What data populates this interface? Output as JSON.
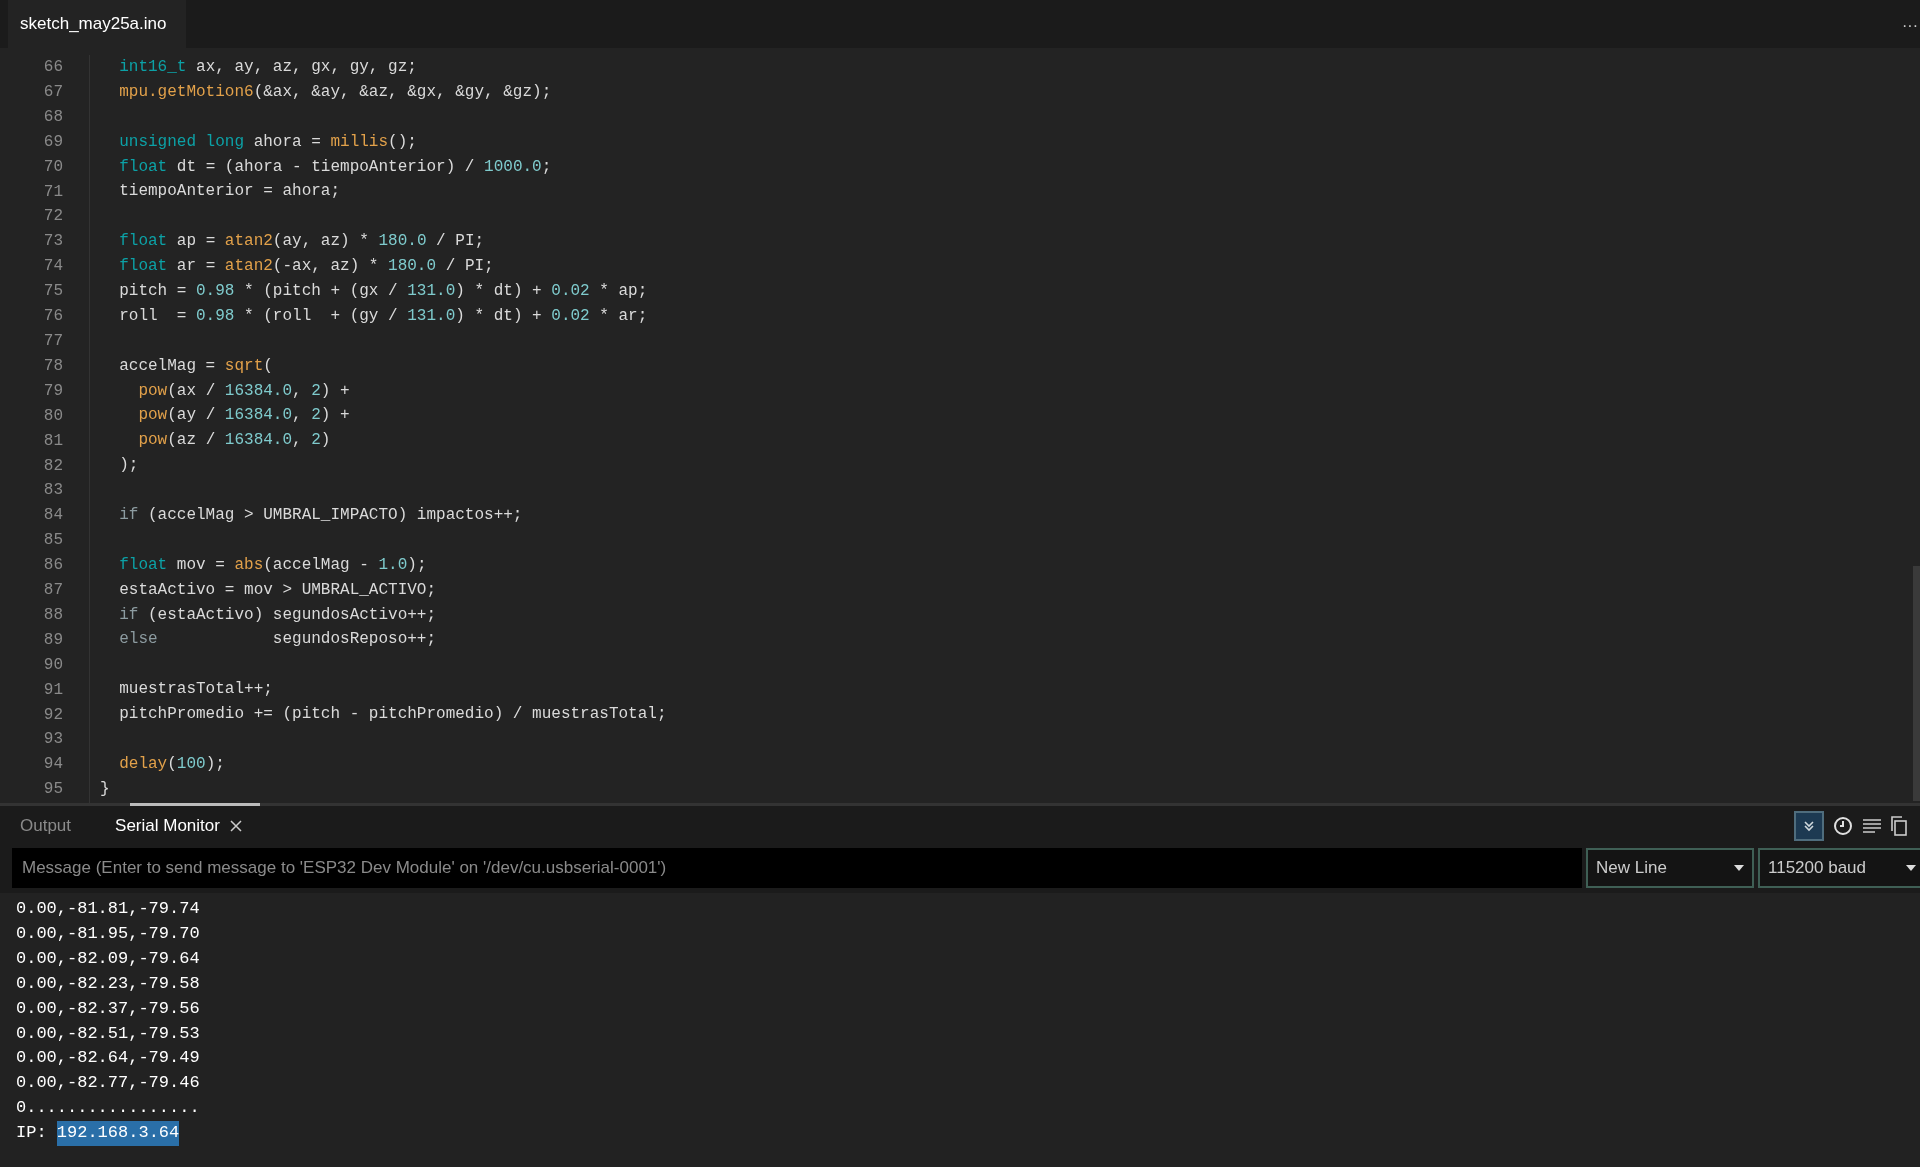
{
  "editor_tab": {
    "label": "sketch_may25a.ino",
    "selected": true
  },
  "more_menu": "···",
  "code_lines": [
    {
      "number": "66",
      "tokens": [
        {
          "kind": "type",
          "text": "  int16_t"
        },
        {
          "kind": "plain",
          "text": " ax, ay, az, gx, gy, gz;"
        }
      ]
    },
    {
      "number": "67",
      "tokens": [
        {
          "kind": "func",
          "text": "  mpu.getMotion6"
        },
        {
          "kind": "plain",
          "text": "(&ax, &ay, &az, &gx, &gy, &gz);"
        }
      ]
    },
    {
      "number": "68"
    },
    {
      "number": "69",
      "tokens": [
        {
          "kind": "type",
          "text": "  unsigned long"
        },
        {
          "kind": "plain",
          "text": " ahora = "
        },
        {
          "kind": "func",
          "text": "millis"
        },
        {
          "kind": "plain",
          "text": "();"
        }
      ]
    },
    {
      "number": "70",
      "tokens": [
        {
          "kind": "type",
          "text": "  float"
        },
        {
          "kind": "plain",
          "text": " dt = (ahora - tiempoAnterior) / "
        },
        {
          "kind": "number",
          "text": "1000.0"
        },
        {
          "kind": "plain",
          "text": ";"
        }
      ]
    },
    {
      "number": "71",
      "tokens": [
        {
          "kind": "plain",
          "text": "  tiempoAnterior = ahora;"
        }
      ]
    },
    {
      "number": "72"
    },
    {
      "number": "73",
      "tokens": [
        {
          "kind": "type",
          "text": "  float"
        },
        {
          "kind": "plain",
          "text": " ap = "
        },
        {
          "kind": "func",
          "text": "atan2"
        },
        {
          "kind": "plain",
          "text": "(ay, az) * "
        },
        {
          "kind": "number",
          "text": "180.0"
        },
        {
          "kind": "plain",
          "text": " / PI;"
        }
      ]
    },
    {
      "number": "74",
      "tokens": [
        {
          "kind": "type",
          "text": "  float"
        },
        {
          "kind": "plain",
          "text": " ar = "
        },
        {
          "kind": "func",
          "text": "atan2"
        },
        {
          "kind": "plain",
          "text": "(-ax, az) * "
        },
        {
          "kind": "number",
          "text": "180.0"
        },
        {
          "kind": "plain",
          "text": " / PI;"
        }
      ]
    },
    {
      "number": "75",
      "tokens": [
        {
          "kind": "plain",
          "text": "  pitch = "
        },
        {
          "kind": "number",
          "text": "0.98"
        },
        {
          "kind": "plain",
          "text": " * (pitch + (gx / "
        },
        {
          "kind": "number",
          "text": "131.0"
        },
        {
          "kind": "plain",
          "text": ") * dt) + "
        },
        {
          "kind": "number",
          "text": "0.02"
        },
        {
          "kind": "plain",
          "text": " * ap;"
        }
      ]
    },
    {
      "number": "76",
      "tokens": [
        {
          "kind": "plain",
          "text": "  roll  = "
        },
        {
          "kind": "number",
          "text": "0.98"
        },
        {
          "kind": "plain",
          "text": " * (roll  + (gy / "
        },
        {
          "kind": "number",
          "text": "131.0"
        },
        {
          "kind": "plain",
          "text": ") * dt) + "
        },
        {
          "kind": "number",
          "text": "0.02"
        },
        {
          "kind": "plain",
          "text": " * ar;"
        }
      ]
    },
    {
      "number": "77"
    },
    {
      "number": "78",
      "tokens": [
        {
          "kind": "plain",
          "text": "  accelMag = "
        },
        {
          "kind": "func",
          "text": "sqrt"
        },
        {
          "kind": "plain",
          "text": "("
        }
      ]
    },
    {
      "number": "79",
      "tokens": [
        {
          "kind": "func",
          "text": "    pow"
        },
        {
          "kind": "plain",
          "text": "(ax / "
        },
        {
          "kind": "number",
          "text": "16384.0"
        },
        {
          "kind": "plain",
          "text": ", "
        },
        {
          "kind": "number",
          "text": "2"
        },
        {
          "kind": "plain",
          "text": ") +"
        }
      ]
    },
    {
      "number": "80",
      "tokens": [
        {
          "kind": "func",
          "text": "    pow"
        },
        {
          "kind": "plain",
          "text": "(ay / "
        },
        {
          "kind": "number",
          "text": "16384.0"
        },
        {
          "kind": "plain",
          "text": ", "
        },
        {
          "kind": "number",
          "text": "2"
        },
        {
          "kind": "plain",
          "text": ") +"
        }
      ]
    },
    {
      "number": "81",
      "tokens": [
        {
          "kind": "func",
          "text": "    pow"
        },
        {
          "kind": "plain",
          "text": "(az / "
        },
        {
          "kind": "number",
          "text": "16384.0"
        },
        {
          "kind": "plain",
          "text": ", "
        },
        {
          "kind": "number",
          "text": "2"
        },
        {
          "kind": "plain",
          "text": ")"
        }
      ]
    },
    {
      "number": "82",
      "tokens": [
        {
          "kind": "plain",
          "text": "  );"
        }
      ]
    },
    {
      "number": "83"
    },
    {
      "number": "84",
      "tokens": [
        {
          "kind": "keyword",
          "text": "  if"
        },
        {
          "kind": "plain",
          "text": " (accelMag > UMBRAL_IMPACTO) impactos++;"
        }
      ]
    },
    {
      "number": "85"
    },
    {
      "number": "86",
      "tokens": [
        {
          "kind": "type",
          "text": "  float"
        },
        {
          "kind": "plain",
          "text": " mov = "
        },
        {
          "kind": "func",
          "text": "abs"
        },
        {
          "kind": "plain",
          "text": "(accelMag - "
        },
        {
          "kind": "number",
          "text": "1.0"
        },
        {
          "kind": "plain",
          "text": ");"
        }
      ]
    },
    {
      "number": "87",
      "tokens": [
        {
          "kind": "plain",
          "text": "  estaActivo = mov > UMBRAL_ACTIVO;"
        }
      ]
    },
    {
      "number": "88",
      "tokens": [
        {
          "kind": "keyword",
          "text": "  if"
        },
        {
          "kind": "plain",
          "text": " (estaActivo) segundosActivo++;"
        }
      ]
    },
    {
      "number": "89",
      "tokens": [
        {
          "kind": "keyword",
          "text": "  else"
        },
        {
          "kind": "plain",
          "text": "            segundosReposo++;"
        }
      ]
    },
    {
      "number": "90"
    },
    {
      "number": "91",
      "tokens": [
        {
          "kind": "plain",
          "text": "  muestrasTotal++;"
        }
      ]
    },
    {
      "number": "92",
      "tokens": [
        {
          "kind": "plain",
          "text": "  pitchPromedio += (pitch - pitchPromedio) / muestrasTotal;"
        }
      ]
    },
    {
      "number": "93"
    },
    {
      "number": "94",
      "tokens": [
        {
          "kind": "func",
          "text": "  delay"
        },
        {
          "kind": "plain",
          "text": "("
        },
        {
          "kind": "number",
          "text": "100"
        },
        {
          "kind": "plain",
          "text": ");"
        }
      ]
    },
    {
      "number": "95",
      "tokens": [
        {
          "kind": "plain",
          "text": "}"
        }
      ]
    }
  ],
  "panel_tabs": [
    {
      "label": "Output",
      "selected": false,
      "closable": false
    },
    {
      "label": "Serial Monitor",
      "selected": true,
      "closable": true
    }
  ],
  "toolbar": {
    "autoscroll_on": true,
    "timestamp_on": false
  },
  "message_field": {
    "placeholder": "Message (Enter to send message to 'ESP32 Dev Module' on '/dev/cu.usbserial-0001')"
  },
  "line_ending": "New Line",
  "baud_rate": "115200 baud",
  "output_lines": [
    {
      "text": "0.00,-81.81,-79.74"
    },
    {
      "text": "0.00,-81.95,-79.70"
    },
    {
      "text": "0.00,-82.09,-79.64"
    },
    {
      "text": "0.00,-82.23,-79.58"
    },
    {
      "text": "0.00,-82.37,-79.56"
    },
    {
      "text": "0.00,-82.51,-79.53"
    },
    {
      "text": "0.00,-82.64,-79.49"
    },
    {
      "text": "0.00,-82.77,-79.46"
    },
    {
      "text": "0................."
    },
    {
      "text": "IP: ",
      "selected_text": "192.168.3.64"
    }
  ]
}
